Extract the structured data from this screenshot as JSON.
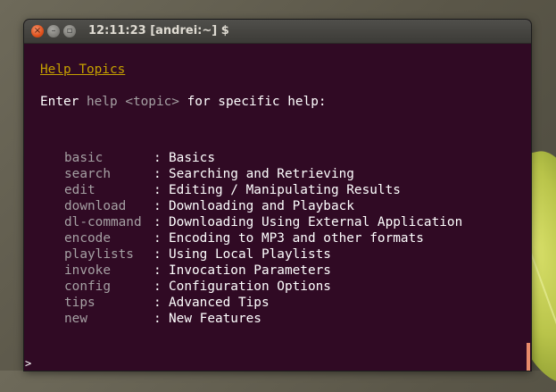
{
  "window": {
    "title": "12:11:23 [andrei:~] $",
    "close_glyph": "×",
    "minimize_glyph": "–",
    "maximize_glyph": "▫"
  },
  "terminal": {
    "heading": "Help Topics",
    "intro_prefix": "Enter ",
    "intro_cmd": "help ",
    "intro_arg": "<topic>",
    "intro_suffix": " for specific help:",
    "separator": ":",
    "topics": [
      {
        "name": "basic",
        "description": "Basics"
      },
      {
        "name": "search",
        "description": "Searching and Retrieving"
      },
      {
        "name": "edit",
        "description": "Editing / Manipulating Results"
      },
      {
        "name": "download",
        "description": "Downloading and Playback"
      },
      {
        "name": "dl-command",
        "description": "Downloading Using External Application"
      },
      {
        "name": "encode",
        "description": "Encoding to MP3 and other formats"
      },
      {
        "name": "playlists",
        "description": "Using Local Playlists"
      },
      {
        "name": "invoke",
        "description": "Invocation Parameters"
      },
      {
        "name": "config",
        "description": "Configuration Options"
      },
      {
        "name": "tips",
        "description": "Advanced Tips"
      },
      {
        "name": "new",
        "description": "New Features"
      }
    ],
    "prompt": ">"
  },
  "colors": {
    "terminal_bg": "#300a24",
    "heading": "#c4a000",
    "topic_name": "#a5a0a3",
    "text": "#ffffff",
    "cursor": "#e88a6a"
  }
}
